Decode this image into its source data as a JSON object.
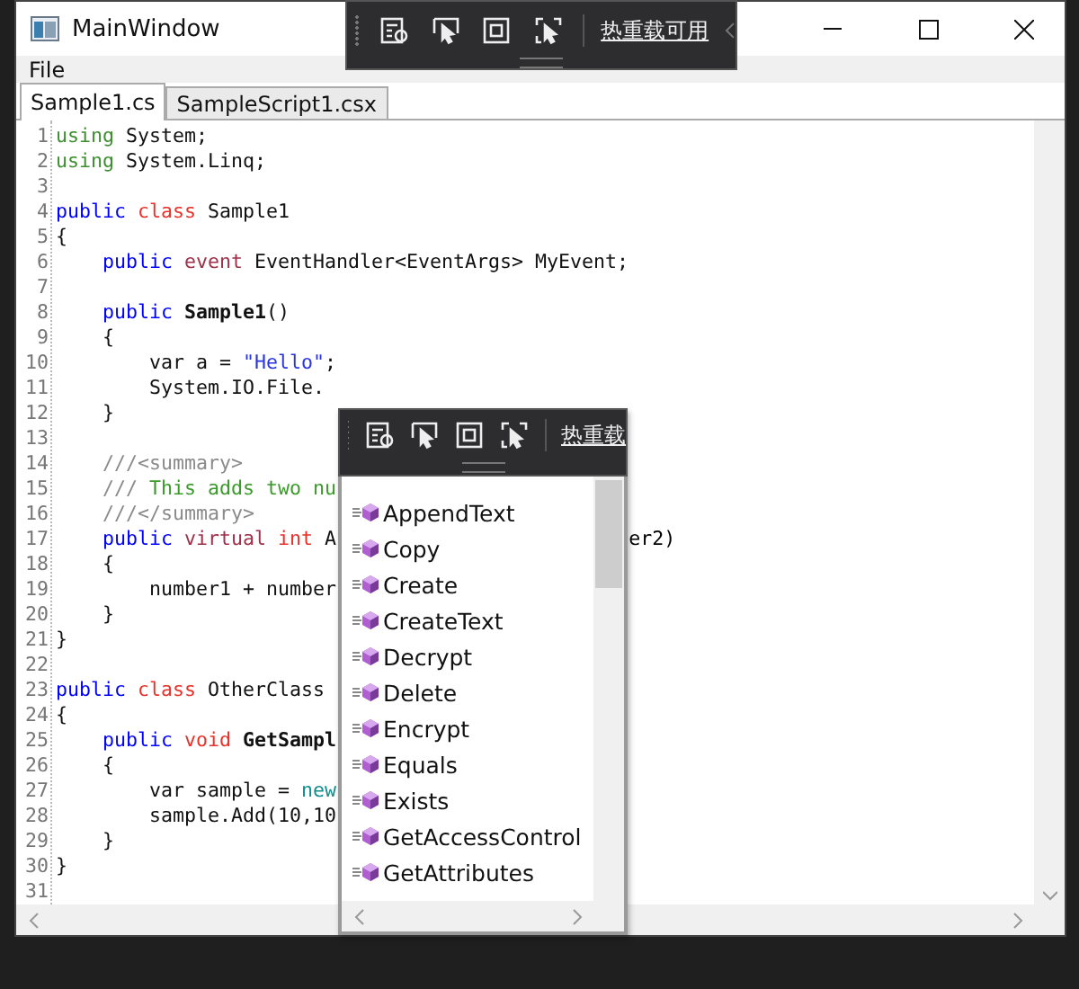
{
  "window": {
    "title": "MainWindow"
  },
  "menu": [
    "File"
  ],
  "tabs": [
    {
      "label": "Sample1.cs",
      "selected": true
    },
    {
      "label": "SampleScript1.csx",
      "selected": false
    }
  ],
  "editor": {
    "lines": [
      {
        "n": "1",
        "tokens": [
          {
            "kind": "using",
            "text": "using "
          },
          {
            "kind": "plain",
            "text": "System;"
          }
        ]
      },
      {
        "n": "2",
        "tokens": [
          {
            "kind": "using",
            "text": "using "
          },
          {
            "kind": "plain",
            "text": "System.Linq;"
          }
        ]
      },
      {
        "n": "3"
      },
      {
        "n": "4",
        "tokens": [
          {
            "kind": "keyword",
            "text": "public "
          },
          {
            "kind": "type",
            "text": "class "
          },
          {
            "kind": "plain",
            "text": "Sample1"
          }
        ]
      },
      {
        "n": "5",
        "tokens": [
          {
            "kind": "plain",
            "text": "{"
          }
        ]
      },
      {
        "n": "6",
        "tokens": [
          {
            "kind": "keyword",
            "text": "    public "
          },
          {
            "kind": "modifier",
            "text": "event "
          },
          {
            "kind": "plain",
            "text": "EventHandler<EventArgs> MyEvent;"
          }
        ]
      },
      {
        "n": "7"
      },
      {
        "n": "8",
        "tokens": [
          {
            "kind": "keyword",
            "text": "    public "
          },
          {
            "kind": "method",
            "text": "Sample1"
          },
          {
            "kind": "plain",
            "text": "()"
          }
        ]
      },
      {
        "n": "9",
        "tokens": [
          {
            "kind": "plain",
            "text": "    {"
          }
        ]
      },
      {
        "n": "10",
        "tokens": [
          {
            "kind": "plain",
            "text": "        var a = "
          },
          {
            "kind": "string",
            "text": "\"Hello\""
          },
          {
            "kind": "plain",
            "text": ";"
          }
        ]
      },
      {
        "n": "11",
        "tokens": [
          {
            "kind": "plain",
            "text": "        System.IO.File."
          }
        ]
      },
      {
        "n": "12",
        "tokens": [
          {
            "kind": "plain",
            "text": "    }"
          }
        ]
      },
      {
        "n": "13"
      },
      {
        "n": "14",
        "tokens": [
          {
            "kind": "doc",
            "text": "    ///<summary>"
          }
        ]
      },
      {
        "n": "15",
        "tokens": [
          {
            "kind": "doc",
            "text": "    ///"
          },
          {
            "kind": "comment",
            "text": " This adds two nu"
          }
        ]
      },
      {
        "n": "16",
        "tokens": [
          {
            "kind": "doc",
            "text": "    ///</summary>"
          }
        ]
      },
      {
        "n": "17",
        "tokens": [
          {
            "kind": "keyword",
            "text": "    public "
          },
          {
            "kind": "modifier",
            "text": "virtual "
          },
          {
            "kind": "type",
            "text": "int "
          },
          {
            "kind": "plain",
            "text": "A"
          }
        ],
        "tail": "er2)"
      },
      {
        "n": "18",
        "tokens": [
          {
            "kind": "plain",
            "text": "    {"
          }
        ]
      },
      {
        "n": "19",
        "tokens": [
          {
            "kind": "plain",
            "text": "        number1 + number"
          }
        ]
      },
      {
        "n": "20",
        "tokens": [
          {
            "kind": "plain",
            "text": "    }"
          }
        ]
      },
      {
        "n": "21",
        "tokens": [
          {
            "kind": "plain",
            "text": "}"
          }
        ]
      },
      {
        "n": "22"
      },
      {
        "n": "23",
        "tokens": [
          {
            "kind": "keyword",
            "text": "public "
          },
          {
            "kind": "type",
            "text": "class "
          },
          {
            "kind": "plain",
            "text": "OtherClass"
          }
        ]
      },
      {
        "n": "24",
        "tokens": [
          {
            "kind": "plain",
            "text": "{"
          }
        ]
      },
      {
        "n": "25",
        "tokens": [
          {
            "kind": "keyword",
            "text": "    public "
          },
          {
            "kind": "type",
            "text": "void "
          },
          {
            "kind": "method",
            "text": "GetSampl"
          }
        ]
      },
      {
        "n": "26",
        "tokens": [
          {
            "kind": "plain",
            "text": "    {"
          }
        ]
      },
      {
        "n": "27",
        "tokens": [
          {
            "kind": "plain",
            "text": "        var sample = "
          },
          {
            "kind": "new",
            "text": "new"
          }
        ]
      },
      {
        "n": "28",
        "tokens": [
          {
            "kind": "plain",
            "text": "        sample.Add(10,10"
          }
        ]
      },
      {
        "n": "29",
        "tokens": [
          {
            "kind": "plain",
            "text": "    }"
          }
        ]
      },
      {
        "n": "30",
        "tokens": [
          {
            "kind": "plain",
            "text": "}"
          }
        ]
      },
      {
        "n": "31"
      }
    ]
  },
  "hot_reload_toolbar": {
    "label": "热重载可用"
  },
  "popup": {
    "toolbar_label": "热重载",
    "items": [
      "AppendText",
      "Copy",
      "Create",
      "CreateText",
      "Decrypt",
      "Delete",
      "Encrypt",
      "Equals",
      "Exists",
      "GetAccessControl",
      "GetAttributes"
    ]
  }
}
